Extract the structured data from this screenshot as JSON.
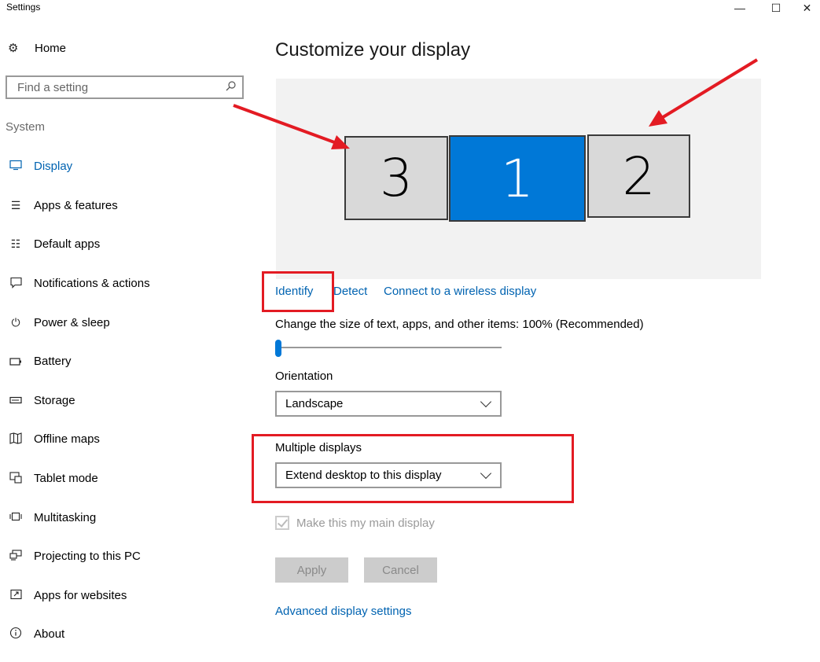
{
  "window": {
    "title": "Settings",
    "minimize_icon": "—",
    "maximize_icon": "☐",
    "close_icon": "✕"
  },
  "sidebar": {
    "home_label": "Home",
    "search_placeholder": "Find a setting",
    "section_label": "System",
    "items": [
      {
        "label": "Display",
        "icon": "monitor-icon",
        "active": true
      },
      {
        "label": "Apps & features",
        "icon": "list-icon"
      },
      {
        "label": "Default apps",
        "icon": "default-apps-icon"
      },
      {
        "label": "Notifications & actions",
        "icon": "speech-bubble-icon"
      },
      {
        "label": "Power & sleep",
        "icon": "power-icon"
      },
      {
        "label": "Battery",
        "icon": "battery-icon"
      },
      {
        "label": "Storage",
        "icon": "storage-icon"
      },
      {
        "label": "Offline maps",
        "icon": "map-icon"
      },
      {
        "label": "Tablet mode",
        "icon": "tablet-icon"
      },
      {
        "label": "Multitasking",
        "icon": "multitasking-icon"
      },
      {
        "label": "Projecting to this PC",
        "icon": "projecting-icon"
      },
      {
        "label": "Apps for websites",
        "icon": "apps-websites-icon"
      },
      {
        "label": "About",
        "icon": "info-icon"
      }
    ]
  },
  "main": {
    "title": "Customize your display",
    "monitors": [
      {
        "number": "3",
        "selected": false
      },
      {
        "number": "1",
        "selected": true
      },
      {
        "number": "2",
        "selected": false
      }
    ],
    "links": {
      "identify": "Identify",
      "detect": "Detect",
      "wireless": "Connect to a wireless display"
    },
    "scale": {
      "label": "Change the size of text, apps, and other items: 100% (Recommended)",
      "slider_position": 0
    },
    "orientation": {
      "label": "Orientation",
      "value": "Landscape"
    },
    "multiple_displays": {
      "label": "Multiple displays",
      "value": "Extend desktop to this display"
    },
    "main_display": {
      "label": "Make this my main display",
      "checked": true,
      "disabled": true
    },
    "buttons": {
      "apply": "Apply",
      "cancel": "Cancel"
    },
    "advanced_link": "Advanced display settings"
  },
  "colors": {
    "accent": "#0078d7",
    "link": "#0063b1",
    "annotation": "#e31b23",
    "monitor_area": "#f2f2f2"
  }
}
